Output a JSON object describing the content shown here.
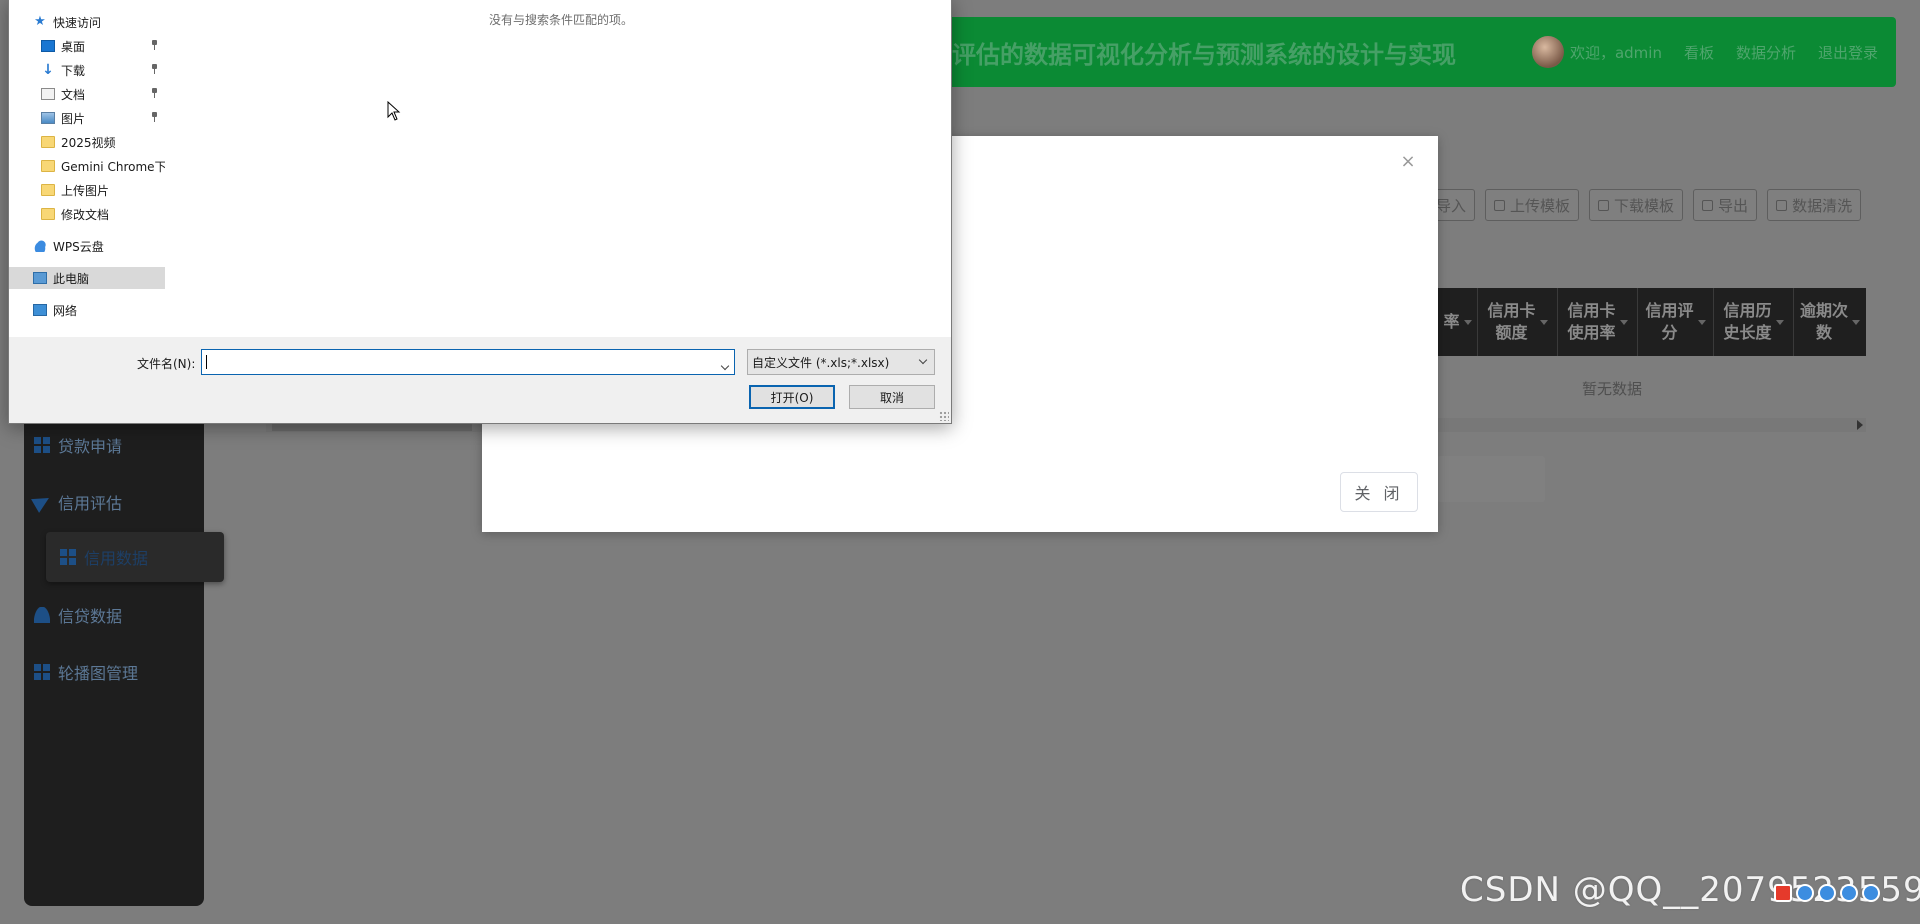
{
  "header": {
    "title": "评估的数据可视化分析与预测系统的设计与实现",
    "welcome": "欢迎，admin",
    "nav": [
      "看板",
      "数据分析",
      "退出登录"
    ]
  },
  "sidebar": {
    "items": [
      {
        "label": "贷款申请",
        "icon": "grid-icon"
      },
      {
        "label": "信用评估",
        "icon": "paper-plane-icon"
      },
      {
        "label": "信贷数据",
        "icon": "user-icon"
      },
      {
        "label": "轮播图管理",
        "icon": "grid-icon"
      }
    ],
    "active_label": "信用数据"
  },
  "toolbar": {
    "import": "导入",
    "upload_template": "上传模板",
    "download_template": "下载模板",
    "export": "导出",
    "data_clean": "数据清洗"
  },
  "table": {
    "columns": [
      {
        "line1": "率",
        "line2": ""
      },
      {
        "line1": "信用卡",
        "line2": "额度"
      },
      {
        "line1": "信用卡",
        "line2": "使用率"
      },
      {
        "line1": "信用评",
        "line2": "分"
      },
      {
        "line1": "信用历",
        "line2": "史长度"
      },
      {
        "line1": "逾期次",
        "line2": "数"
      }
    ],
    "empty_text": "暂无数据"
  },
  "modal": {
    "close_label": "关 闭"
  },
  "file_dialog": {
    "quick_access": "快速访问",
    "nav_items": [
      {
        "label": "桌面",
        "pinned": true,
        "icon": "desktop-icon"
      },
      {
        "label": "下载",
        "pinned": true,
        "icon": "download-arrow-icon"
      },
      {
        "label": "文档",
        "pinned": true,
        "icon": "document-icon"
      },
      {
        "label": "图片",
        "pinned": true,
        "icon": "picture-icon"
      },
      {
        "label": "2025视频",
        "pinned": false,
        "icon": "folder-icon"
      },
      {
        "label": "Gemini Chrome下",
        "pinned": false,
        "icon": "folder-icon"
      },
      {
        "label": "上传图片",
        "pinned": false,
        "icon": "folder-icon"
      },
      {
        "label": "修改文档",
        "pinned": false,
        "icon": "folder-icon"
      }
    ],
    "wps_cloud": "WPS云盘",
    "this_pc": "此电脑",
    "network": "网络",
    "no_results": "没有与搜索条件匹配的项。",
    "filename_label": "文件名(N):",
    "filename_value": "",
    "filetype": "自定义文件 (*.xls;*.xlsx)",
    "open_button": "打开(O)",
    "cancel_button": "取消"
  },
  "watermark": "CSDN @QQ__2079523559",
  "colors": {
    "header_bg": "#0b8a34",
    "overlay_bg": "#7d7d7d",
    "sidebar_bg": "#1e1e1e",
    "dialog_accent": "#0a64b0"
  }
}
